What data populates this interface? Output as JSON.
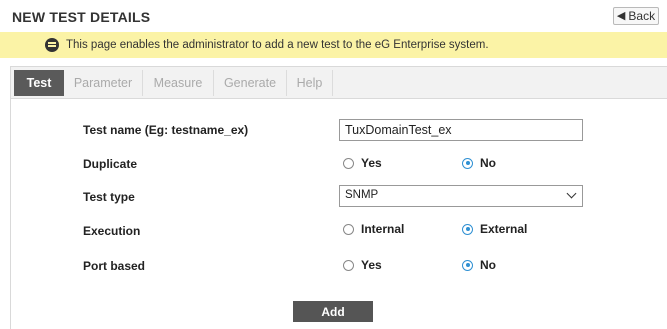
{
  "header": {
    "title": "NEW TEST DETAILS",
    "back_label": "Back"
  },
  "info": {
    "message": "This page enables the administrator to add a new test to the eG Enterprise system."
  },
  "tabs": [
    {
      "label": "Test",
      "active": true
    },
    {
      "label": "Parameter",
      "active": false
    },
    {
      "label": "Measure",
      "active": false
    },
    {
      "label": "Generate",
      "active": false
    },
    {
      "label": "Help",
      "active": false
    }
  ],
  "form": {
    "test_name": {
      "label": "Test name (Eg: testname_ex)",
      "value": "TuxDomainTest_ex"
    },
    "duplicate": {
      "label": "Duplicate",
      "options": [
        "Yes",
        "No"
      ],
      "selected": "No"
    },
    "test_type": {
      "label": "Test type",
      "value": "SNMP"
    },
    "execution": {
      "label": "Execution",
      "options": [
        "Internal",
        "External"
      ],
      "selected": "External"
    },
    "port_based": {
      "label": "Port based",
      "options": [
        "Yes",
        "No"
      ],
      "selected": "No"
    }
  },
  "actions": {
    "add_label": "Add"
  },
  "colors": {
    "info_bar": "#fbf3a6",
    "active_tab": "#5a5a5a",
    "radio_accent": "#2f90d3",
    "button": "#555555"
  }
}
